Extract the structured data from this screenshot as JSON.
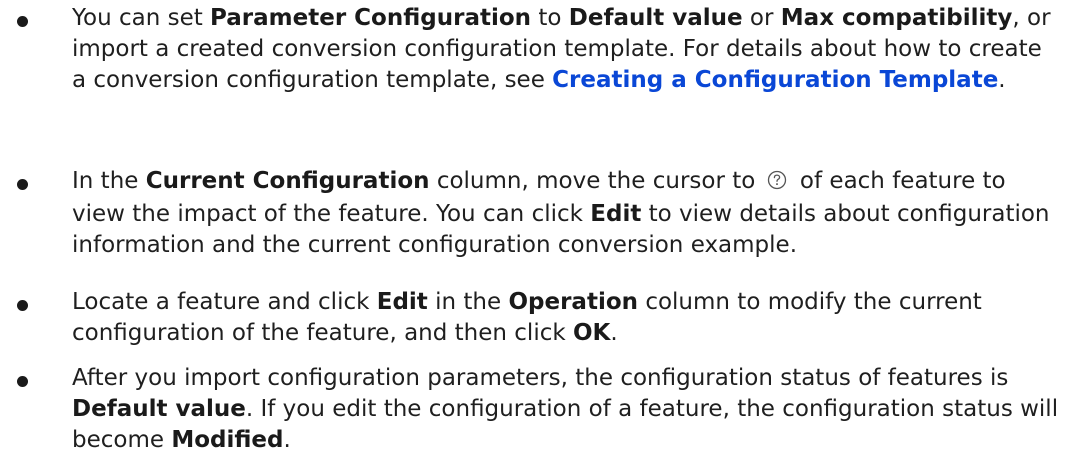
{
  "bullets": [
    {
      "t1": "You can set ",
      "b1": "Parameter Configuration",
      "t2": " to ",
      "b2": "Default value",
      "t3": " or ",
      "b3": "Max compatibility",
      "t4": ", or import a created conversion configuration template. For details about how to create a conversion configuration template, see ",
      "link": "Creating a Configuration Template",
      "t5": "."
    },
    {
      "t1": "In the ",
      "b1": "Current Configuration",
      "t2": " column, move the cursor to ",
      "icon": "question-circle-icon",
      "t3": " of each feature to view the impact of the feature. You can click ",
      "b2": "Edit",
      "t4": " to view details about configuration information and the current configuration conversion example."
    },
    {
      "t1": "Locate a feature and click ",
      "b1": "Edit",
      "t2": " in the ",
      "b2": "Operation",
      "t3": " column to modify the current configuration of the feature, and then click ",
      "b3": "OK",
      "t4": "."
    },
    {
      "t1": "After you import configuration parameters, the configuration status of features is ",
      "b1": "Default value",
      "t2": ". If you edit the configuration of a feature, the configuration status will become ",
      "b2": "Modified",
      "t3": "."
    }
  ],
  "colors": {
    "text": "#1a1a1a",
    "link": "#0a47d6",
    "icon": "#555555"
  }
}
